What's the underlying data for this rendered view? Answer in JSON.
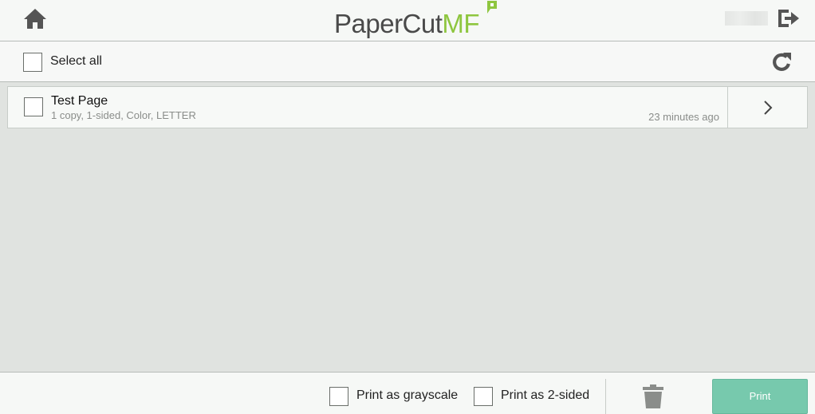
{
  "header": {
    "logo_brand": "PaperCut",
    "logo_suffix": "MF",
    "home_icon": "home-icon",
    "logout_icon": "logout-icon"
  },
  "toolbar": {
    "select_all_label": "Select all",
    "refresh_icon": "refresh-icon"
  },
  "jobs": [
    {
      "title": "Test Page",
      "details": "1 copy, 1-sided, Color, LETTER",
      "time": "23 minutes ago",
      "detail_icon": "chevron-right-icon"
    }
  ],
  "footer": {
    "grayscale_label": "Print as grayscale",
    "duplex_label": "Print as 2-sided",
    "delete_icon": "trash-icon",
    "print_label": "Print"
  },
  "colors": {
    "accent": "#77c9ad",
    "logo_green": "#8ec63f",
    "icon_gray": "#555555"
  }
}
